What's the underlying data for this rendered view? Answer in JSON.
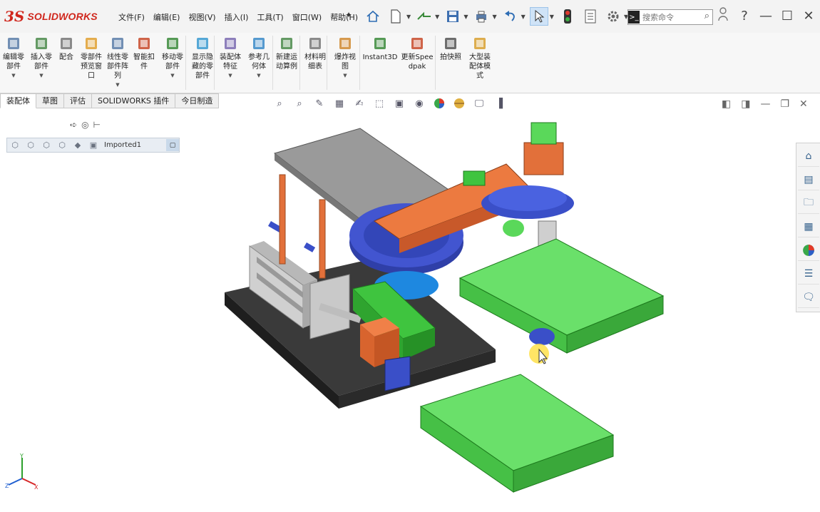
{
  "app": {
    "logo_mark": "3S",
    "logo_text": "SOLIDWORKS"
  },
  "menu": [
    "文件(F)",
    "编辑(E)",
    "视图(V)",
    "插入(I)",
    "工具(T)",
    "窗口(W)",
    "帮助(H)"
  ],
  "search": {
    "prefix": ">_",
    "placeholder": "搜索命令"
  },
  "window_controls": {
    "help": "?",
    "minimize": "—",
    "maximize": "☐",
    "close": "✕"
  },
  "ribbon": [
    {
      "label": "编辑零部件",
      "icon": "edit-component-icon"
    },
    {
      "label": "插入零部件",
      "icon": "insert-component-icon"
    },
    {
      "label": "配合",
      "icon": "mate-icon"
    },
    {
      "label": "零部件预览窗口",
      "icon": "preview-window-icon"
    },
    {
      "label": "线性零部件阵列",
      "icon": "linear-pattern-icon"
    },
    {
      "label": "智能扣件",
      "icon": "smart-fasteners-icon"
    },
    {
      "label": "移动零部件",
      "icon": "move-component-icon"
    },
    {
      "label": "显示隐藏的零部件",
      "icon": "show-hidden-icon"
    },
    {
      "label": "装配体特征",
      "icon": "assembly-features-icon"
    },
    {
      "label": "参考几何体",
      "icon": "reference-geometry-icon"
    },
    {
      "label": "新建运动算例",
      "icon": "motion-study-icon"
    },
    {
      "label": "材料明细表",
      "icon": "bom-icon"
    },
    {
      "label": "爆炸视图",
      "icon": "exploded-view-icon"
    },
    {
      "label": "Instant3D",
      "icon": "instant3d-icon"
    },
    {
      "label": "更新Speedpak",
      "icon": "speedpak-icon"
    },
    {
      "label": "拍快照",
      "icon": "snapshot-icon"
    },
    {
      "label": "大型装配体模式",
      "icon": "large-assembly-icon"
    }
  ],
  "tabs": [
    "装配体",
    "草图",
    "评估",
    "SOLIDWORKS 插件",
    "今日制造"
  ],
  "active_tab": 0,
  "breadcrumb": {
    "label": "Imported1"
  },
  "colors": {
    "accent": "#d0271d",
    "ribbon_bg": "#f7f7f7",
    "selection": "#cfe3f7",
    "model_orange": "#e2703a",
    "model_blue": "#3a4fc8",
    "model_green": "#4fd04f",
    "model_gray": "#9a9a9a"
  }
}
